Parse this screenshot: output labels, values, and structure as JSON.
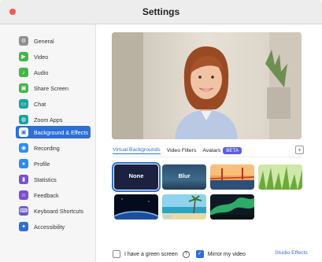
{
  "window": {
    "title": "Settings"
  },
  "sidebar": {
    "items": [
      {
        "label": "General",
        "icon": "gear-icon",
        "color": "#8e8e8e"
      },
      {
        "label": "Video",
        "icon": "video-camera-icon",
        "color": "#43b64a"
      },
      {
        "label": "Audio",
        "icon": "headphones-icon",
        "color": "#43b64a"
      },
      {
        "label": "Share Screen",
        "icon": "share-screen-icon",
        "color": "#43b64a"
      },
      {
        "label": "Chat",
        "icon": "chat-bubble-icon",
        "color": "#1aa3a3"
      },
      {
        "label": "Zoom Apps",
        "icon": "apps-icon",
        "color": "#1aa3a3"
      },
      {
        "label": "Background & Effects",
        "icon": "background-icon",
        "color": "#2d6fd6",
        "active": true
      },
      {
        "label": "Recording",
        "icon": "record-icon",
        "color": "#2d8cf0"
      },
      {
        "label": "Profile",
        "icon": "person-icon",
        "color": "#2d8cf0"
      },
      {
        "label": "Statistics",
        "icon": "bar-chart-icon",
        "color": "#7b4fd6"
      },
      {
        "label": "Feedback",
        "icon": "feedback-icon",
        "color": "#7b4fd6"
      },
      {
        "label": "Keyboard Shortcuts",
        "icon": "keyboard-icon",
        "color": "#6a5acd"
      },
      {
        "label": "Accessibility",
        "icon": "accessibility-icon",
        "color": "#2d6fd6"
      }
    ]
  },
  "tabs": {
    "virtual": "Virtual Backgrounds",
    "filters": "Video Filters",
    "avatars": "Avatars",
    "beta": "BETA"
  },
  "backgrounds": {
    "none": "None",
    "blur": "Blur",
    "items": [
      "golden-gate-bridge",
      "grass",
      "earth-from-space",
      "beach",
      "aurora"
    ]
  },
  "footer": {
    "green_screen": "I have a green screen",
    "mirror": "Mirror my video",
    "studio": "Studio Effects"
  }
}
